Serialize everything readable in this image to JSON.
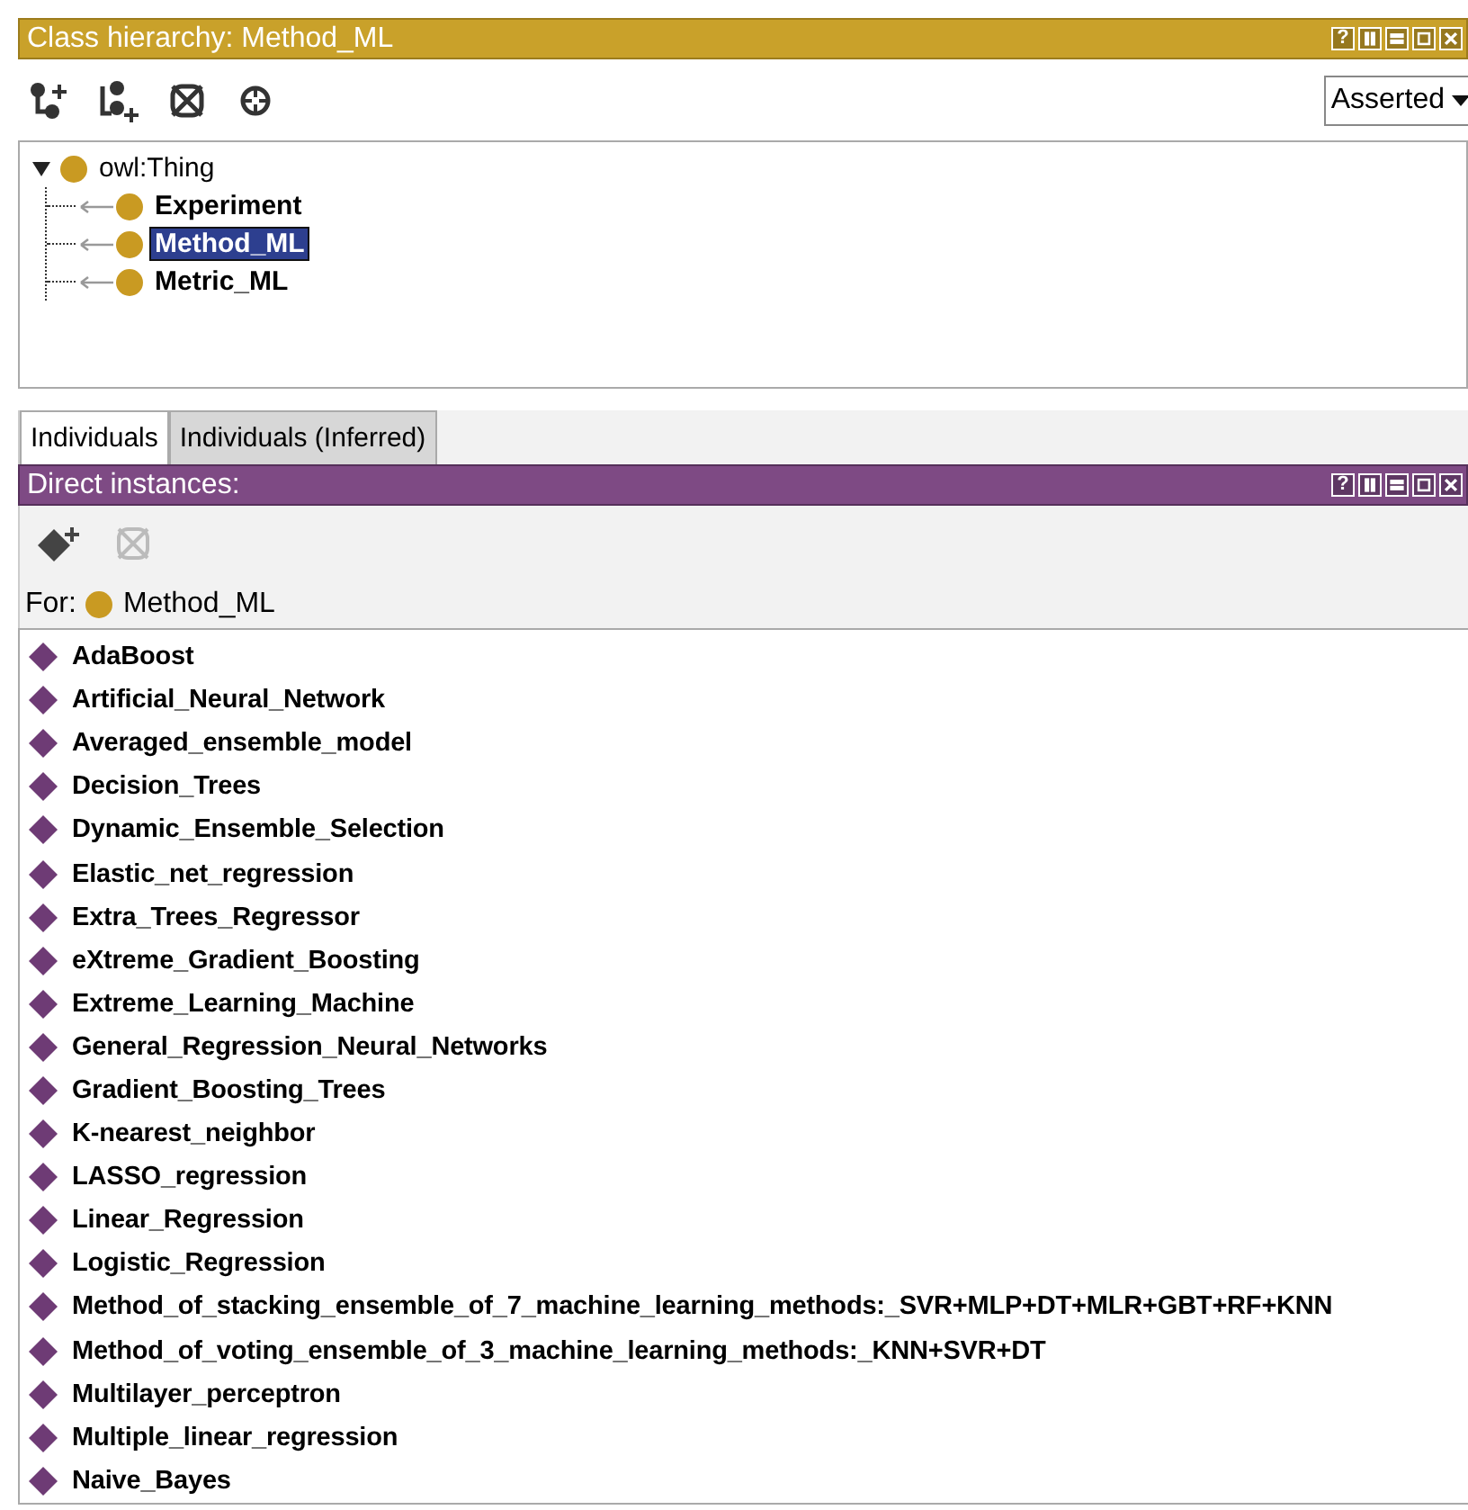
{
  "class_panel": {
    "title": "Class hierarchy: Method_ML",
    "help": "?",
    "view_select": {
      "value": "Asserted"
    },
    "tree": [
      {
        "label": "owl:Thing",
        "expanded": true,
        "selected": false,
        "children": [
          {
            "label": "Experiment",
            "selected": false
          },
          {
            "label": "Method_ML",
            "selected": true
          },
          {
            "label": "Metric_ML",
            "selected": false
          }
        ]
      }
    ]
  },
  "tabs": [
    {
      "label": "Individuals",
      "selected": true
    },
    {
      "label": "Individuals (Inferred)",
      "selected": false
    }
  ],
  "instances_panel": {
    "title": "Direct instances:",
    "help": "?",
    "for_label": "For:",
    "for_class": "Method_ML",
    "items": [
      "AdaBoost",
      "Artificial_Neural_Network",
      "Averaged_ensemble_model",
      "Decision_Trees",
      "Dynamic_Ensemble_Selection",
      "Elastic_net_regression",
      "Extra_Trees_Regressor",
      "eXtreme_Gradient_Boosting",
      "Extreme_Learning_Machine",
      "General_Regression_Neural_Networks",
      "Gradient_Boosting_Trees",
      "K-nearest_neighbor",
      "LASSO_regression",
      "Linear_Regression",
      "Logistic_Regression",
      "Method_of_stacking_ensemble_of_7_machine_learning_methods:_SVR+MLP+DT+MLR+GBT+RF+KNN",
      "Method_of_voting_ensemble_of_3_machine_learning_methods:_KNN+SVR+DT",
      "Multilayer_perceptron",
      "Multiple_linear_regression",
      "Naive_Bayes"
    ]
  }
}
